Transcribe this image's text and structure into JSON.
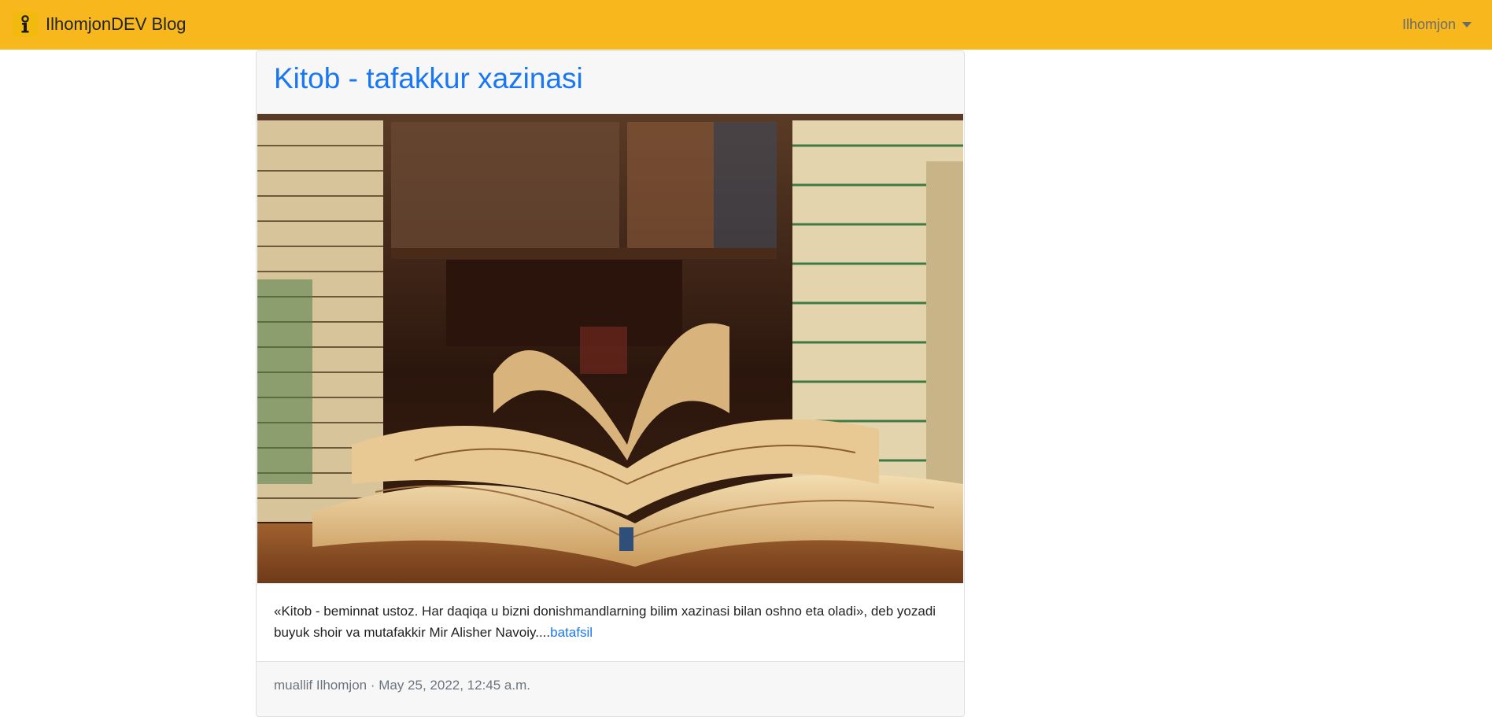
{
  "navbar": {
    "brand": "IlhomjonDEV Blog",
    "user": "Ilhomjon",
    "logo_icon": "info-person-icon",
    "background_color": "#f7b71d"
  },
  "post": {
    "title": "Kitob - tafakkur xazinasi",
    "image_icon": "books-photo",
    "excerpt": "«Kitob - beminnat ustoz. Har daqiqa u bizni donishmandlarning bilim xazinasi bilan oshno eta oladi», deb yozadi buyuk shoir va mutafakkir Mir Alisher Navoiy....",
    "read_more": "batafsil",
    "meta": "muallif Ilhomjon · May 25, 2022, 12:45 a.m.",
    "title_color": "#1877f2"
  }
}
